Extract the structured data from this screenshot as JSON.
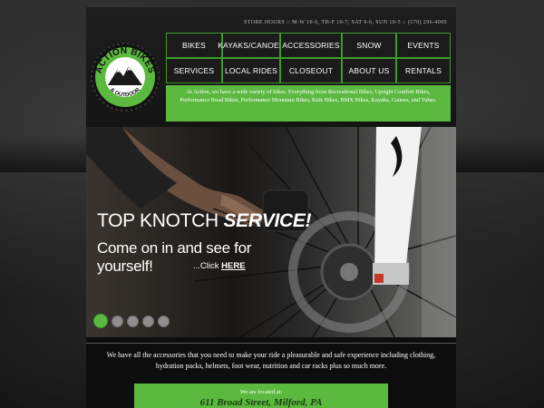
{
  "store_hours": "STORE HOURS :: M-W 10-6, TH-F 10-7, SAT 9-6, SUN 10-5 :: (570) 296-4009",
  "logo": {
    "line1": "ACTION BIKES",
    "line2": "& OUTDOOR",
    "colors": {
      "ring": "#5cb93f",
      "outer": "#111111",
      "mountains": "#1a1a1a"
    }
  },
  "nav": {
    "items": [
      {
        "label": "Bikes"
      },
      {
        "label": "Kayaks/Canoes"
      },
      {
        "label": "Accessories"
      },
      {
        "label": "Snow"
      },
      {
        "label": "Events"
      },
      {
        "label": "Services"
      },
      {
        "label": "Local Rides"
      },
      {
        "label": "Closeout"
      },
      {
        "label": "About Us"
      },
      {
        "label": "Rentals"
      }
    ]
  },
  "intro_text": "At Action, we have a wide variety of bikes. Everything from Recreational Bikes, Upright Comfort Bikes, Performance Road Bikes, Performance Mountain Bikes, Kids Bikes, BMX Bikes, Kayaks, Canoes, and Tubes.",
  "hero": {
    "headline_plain": "TOP KNOTCH ",
    "headline_emphasis": "SERVICE!",
    "subline": "Come on in and see for yourself!",
    "click_prefix": "...Click ",
    "click_link": "HERE",
    "slides": 5,
    "active_slide": 1
  },
  "accessories_text": "We have all the accessories that you need to make your ride a pleasurable and safe experience including clothing, hydration packs, helmets, foot wear, nutrition and car racks plus so much more.",
  "location": {
    "label": "We are located at:",
    "address": "611 Broad Street, Milford, PA"
  },
  "colors": {
    "accent": "#5cb93f",
    "nav_border": "#3f9a2c",
    "background": "#161616"
  }
}
